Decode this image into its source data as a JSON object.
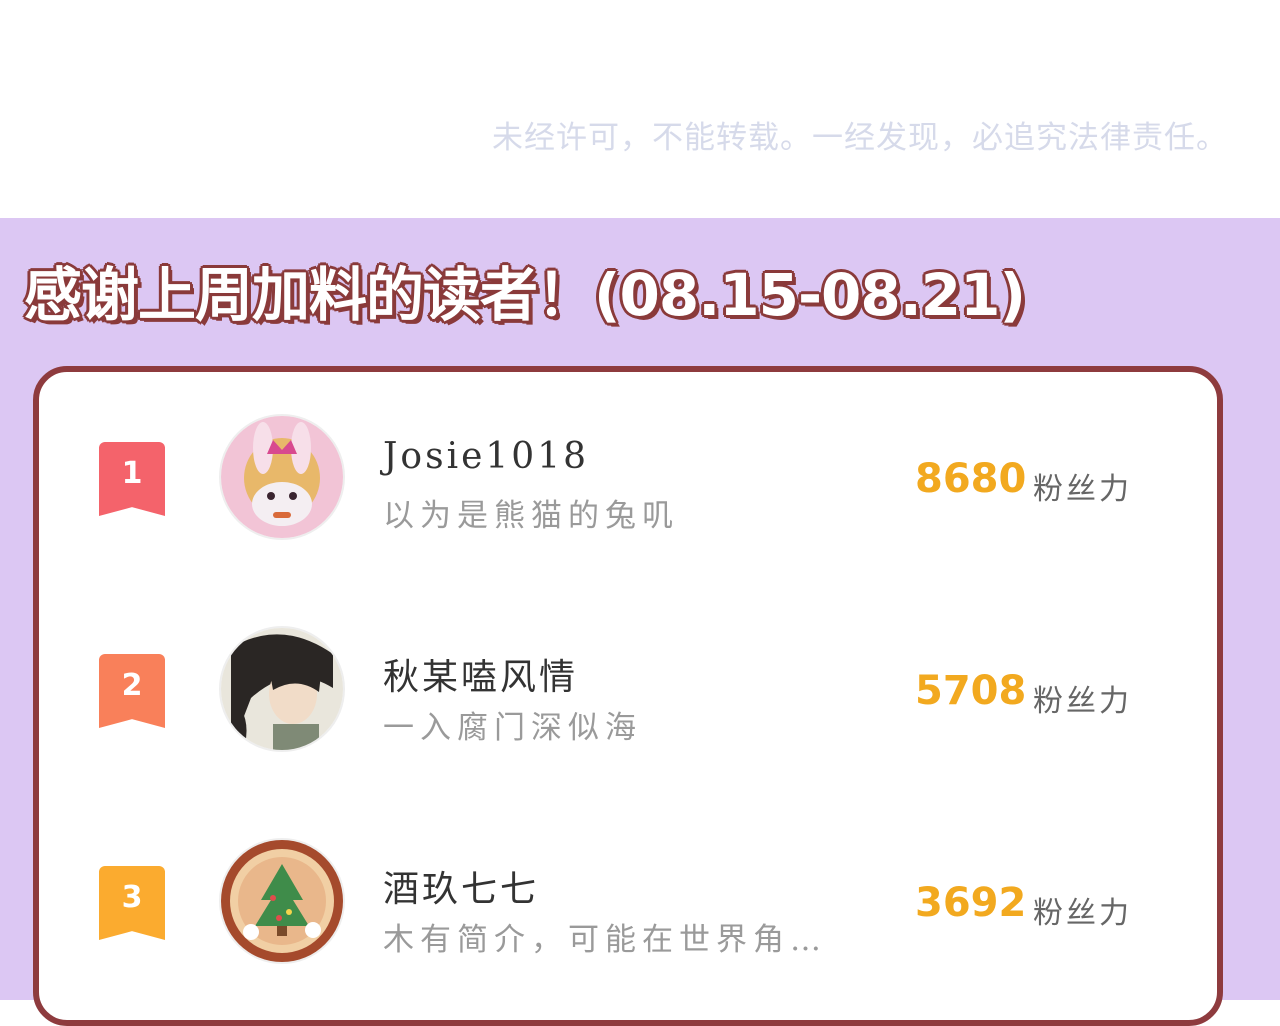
{
  "copyright_notice": "未经许可，不能转载。一经发现，必追究法律责任。",
  "title": "感谢上周加料的读者！(08.15-08.21)",
  "leaderboard": [
    {
      "rank": "1",
      "username": "Josie1018",
      "bio": "以为是熊猫的兔叽",
      "score": "8680",
      "unit": "粉丝力",
      "badge_color": "#f4636b",
      "avatar_icon": "bunny-avatar"
    },
    {
      "rank": "2",
      "username": "秋某嗑风情",
      "bio": "一入腐门深似海",
      "score": "5708",
      "unit": "粉丝力",
      "badge_color": "#f9805a",
      "avatar_icon": "anime-portrait-avatar"
    },
    {
      "rank": "3",
      "username": "酒玖七七",
      "bio": "木有简介，可能在世界角…",
      "score": "3692",
      "unit": "粉丝力",
      "badge_color": "#fbab2f",
      "avatar_icon": "christmas-tree-avatar"
    }
  ],
  "colors": {
    "banner_bg": "#dcc7f3",
    "card_border": "#8e3b3e",
    "score": "#f2a91f",
    "title_outline": "#8a3a3a"
  }
}
